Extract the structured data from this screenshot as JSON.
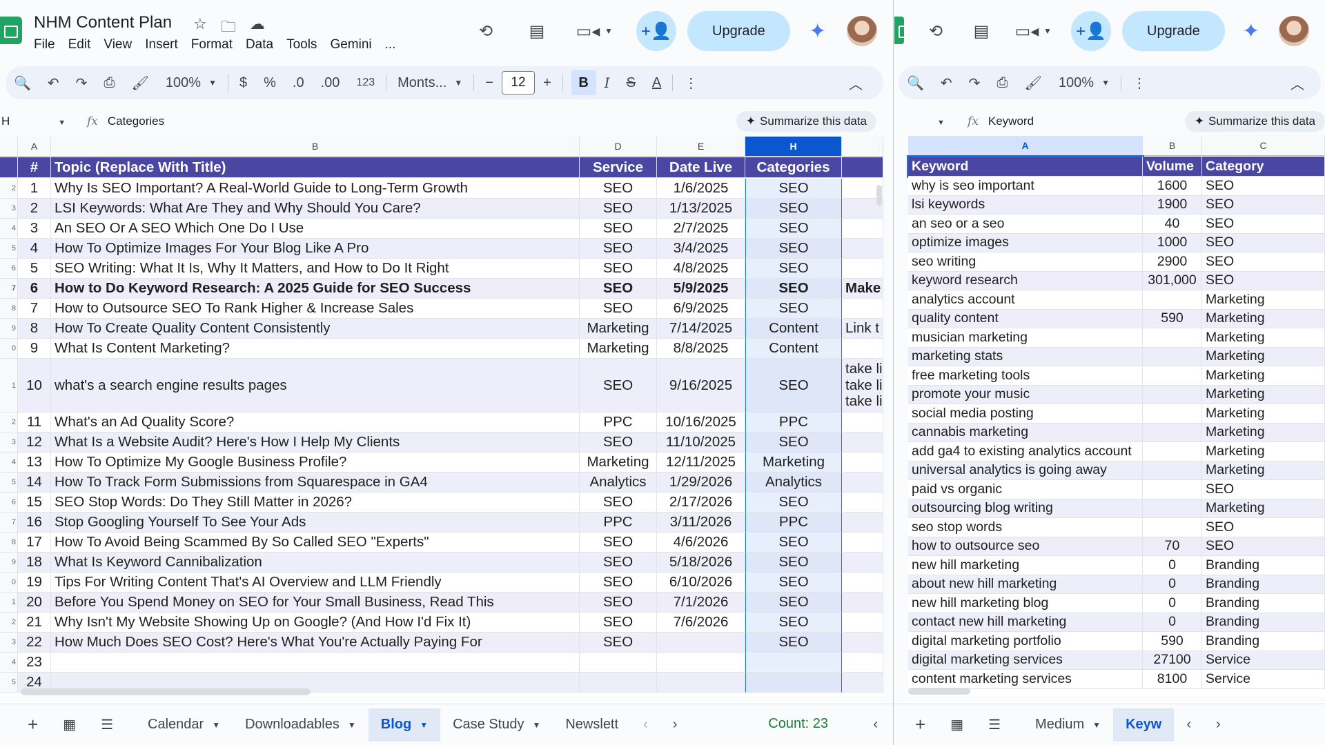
{
  "left": {
    "doc_title": "NHM Content Plan",
    "menu": [
      "File",
      "Edit",
      "View",
      "Insert",
      "Format",
      "Data",
      "Tools",
      "Gemini",
      "..."
    ],
    "upgrade_label": "Upgrade",
    "zoom": "100%",
    "currency": "$",
    "percent": "%",
    "dec_less": ".0",
    "dec_more": ".00",
    "num_fmt": "123",
    "font_name": "Monts...",
    "font_size": "12",
    "name_box": "H",
    "formula": "Categories",
    "summarize_label": "Summarize this data",
    "col_letters": [
      "A",
      "B",
      "D",
      "E",
      "H"
    ],
    "header": [
      "#",
      "Topic (Replace With Title)",
      "Service",
      "Date Live",
      "Categories"
    ],
    "row_numbers": [
      "",
      "",
      "2",
      "3",
      "4",
      "5",
      "6",
      "7",
      "8",
      "9",
      "0",
      "1",
      "2",
      "3",
      "4",
      "5",
      "6",
      "7",
      "8",
      "9",
      "0",
      "1",
      "2",
      "3",
      "4",
      "5"
    ],
    "rows": [
      {
        "n": "1",
        "topic": "Why Is SEO Important? A Real-World Guide to Long-Term Growth",
        "service": "SEO",
        "date": "1/6/2025",
        "cat": "SEO",
        "extra": ""
      },
      {
        "n": "2",
        "topic": "LSI Keywords: What Are They and Why Should You Care?",
        "service": "SEO",
        "date": "1/13/2025",
        "cat": "SEO",
        "extra": ""
      },
      {
        "n": "3",
        "topic": "An SEO Or A SEO Which One Do I Use",
        "service": "SEO",
        "date": "2/7/2025",
        "cat": "SEO",
        "extra": ""
      },
      {
        "n": "4",
        "topic": "How To Optimize Images For Your Blog Like A Pro",
        "service": "SEO",
        "date": "3/4/2025",
        "cat": "SEO",
        "extra": ""
      },
      {
        "n": "5",
        "topic": "SEO Writing: What It Is, Why It Matters, and How to Do It Right",
        "service": "SEO",
        "date": "4/8/2025",
        "cat": "SEO",
        "extra": ""
      },
      {
        "n": "6",
        "topic": "How to Do Keyword Research: A 2025 Guide for SEO Success",
        "service": "SEO",
        "date": "5/9/2025",
        "cat": "SEO",
        "extra": "Make"
      },
      {
        "n": "7",
        "topic": "How to Outsource SEO To Rank Higher & Increase Sales",
        "service": "SEO",
        "date": "6/9/2025",
        "cat": "SEO",
        "extra": ""
      },
      {
        "n": "8",
        "topic": "How To Create Quality Content Consistently",
        "service": "Marketing",
        "date": "7/14/2025",
        "cat": "Content",
        "extra": "Link t"
      },
      {
        "n": "9",
        "topic": "What Is Content Marketing?",
        "service": "Marketing",
        "date": "8/8/2025",
        "cat": "Content",
        "extra": ""
      },
      {
        "n": "10",
        "topic": "what's a search engine results pages",
        "service": "SEO",
        "date": "9/16/2025",
        "cat": "SEO",
        "extra": "take li\ntake li\ntake li"
      },
      {
        "n": "11",
        "topic": "What's an Ad Quality Score?",
        "service": "PPC",
        "date": "10/16/2025",
        "cat": "PPC",
        "extra": ""
      },
      {
        "n": "12",
        "topic": "What Is a Website Audit? Here's How I Help My Clients",
        "service": "SEO",
        "date": "11/10/2025",
        "cat": "SEO",
        "extra": ""
      },
      {
        "n": "13",
        "topic": "How To Optimize My Google Business Profile?",
        "service": "Marketing",
        "date": "12/11/2025",
        "cat": "Marketing",
        "extra": ""
      },
      {
        "n": "14",
        "topic": "How To Track Form Submissions from Squarespace in GA4",
        "service": "Analytics",
        "date": "1/29/2026",
        "cat": "Analytics",
        "extra": ""
      },
      {
        "n": "15",
        "topic": "SEO Stop Words: Do They Still Matter in 2026?",
        "service": "SEO",
        "date": "2/17/2026",
        "cat": "SEO",
        "extra": ""
      },
      {
        "n": "16",
        "topic": "Stop Googling Yourself To See Your Ads",
        "service": "PPC",
        "date": "3/11/2026",
        "cat": "PPC",
        "extra": ""
      },
      {
        "n": "17",
        "topic": "How To Avoid Being Scammed By So Called SEO \"Experts\"",
        "service": "SEO",
        "date": "4/6/2026",
        "cat": "SEO",
        "extra": ""
      },
      {
        "n": "18",
        "topic": "What Is Keyword Cannibalization",
        "service": "SEO",
        "date": "5/18/2026",
        "cat": "SEO",
        "extra": ""
      },
      {
        "n": "19",
        "topic": "Tips For Writing Content That's AI Overview and LLM Friendly",
        "service": "SEO",
        "date": "6/10/2026",
        "cat": "SEO",
        "extra": ""
      },
      {
        "n": "20",
        "topic": "Before You Spend Money on SEO for Your Small Business, Read This",
        "service": "SEO",
        "date": "7/1/2026",
        "cat": "SEO",
        "extra": ""
      },
      {
        "n": "21",
        "topic": "Why Isn't My Website Showing Up on Google? (And How I'd Fix It)",
        "service": "SEO",
        "date": "7/6/2026",
        "cat": "SEO",
        "extra": ""
      },
      {
        "n": "22",
        "topic": "How Much Does SEO Cost? Here's What You're Actually Paying For",
        "service": "SEO",
        "date": "",
        "cat": "SEO",
        "extra": ""
      },
      {
        "n": "23",
        "topic": "",
        "service": "",
        "date": "",
        "cat": "",
        "extra": ""
      },
      {
        "n": "24",
        "topic": "",
        "service": "",
        "date": "",
        "cat": "",
        "extra": ""
      }
    ],
    "tabs": [
      "Calendar",
      "Downloadables",
      "Blog",
      "Case Study",
      "Newslett"
    ],
    "active_tab": "Blog",
    "count": "Count: 23"
  },
  "right": {
    "upgrade_label": "Upgrade",
    "zoom": "100%",
    "formula": "Keyword",
    "summarize_label": "Summarize this data",
    "col_letters": [
      "A",
      "B",
      "C"
    ],
    "header": [
      "Keyword",
      "Volume",
      "Category"
    ],
    "rows": [
      {
        "k": "why is seo important",
        "v": "1600",
        "c": "SEO"
      },
      {
        "k": "lsi keywords",
        "v": "1900",
        "c": "SEO"
      },
      {
        "k": "an seo or a seo",
        "v": "40",
        "c": "SEO"
      },
      {
        "k": "optimize images",
        "v": "1000",
        "c": "SEO"
      },
      {
        "k": "seo writing",
        "v": "2900",
        "c": "SEO"
      },
      {
        "k": "keyword research",
        "v": "301,000",
        "c": "SEO"
      },
      {
        "k": "analytics account",
        "v": "",
        "c": "Marketing"
      },
      {
        "k": "quality content",
        "v": "590",
        "c": "Marketing"
      },
      {
        "k": "musician marketing",
        "v": "",
        "c": "Marketing"
      },
      {
        "k": "marketing stats",
        "v": "",
        "c": "Marketing"
      },
      {
        "k": "free marketing tools",
        "v": "",
        "c": "Marketing"
      },
      {
        "k": "promote your music",
        "v": "",
        "c": "Marketing"
      },
      {
        "k": "social media posting",
        "v": "",
        "c": "Marketing"
      },
      {
        "k": "cannabis marketing",
        "v": "",
        "c": "Marketing"
      },
      {
        "k": "add ga4 to existing analytics account",
        "v": "",
        "c": "Marketing"
      },
      {
        "k": "universal analytics is going away",
        "v": "",
        "c": "Marketing"
      },
      {
        "k": "paid vs organic",
        "v": "",
        "c": "SEO"
      },
      {
        "k": "outsourcing blog writing",
        "v": "",
        "c": "Marketing"
      },
      {
        "k": "seo stop words",
        "v": "",
        "c": "SEO"
      },
      {
        "k": "how to outsource seo",
        "v": "70",
        "c": "SEO"
      },
      {
        "k": "new hill marketing",
        "v": "0",
        "c": "Branding"
      },
      {
        "k": "about new hill marketing",
        "v": "0",
        "c": "Branding"
      },
      {
        "k": "new hill marketing blog",
        "v": "0",
        "c": "Branding"
      },
      {
        "k": "contact new hill marketing",
        "v": "0",
        "c": "Branding"
      },
      {
        "k": "digital marketing portfolio",
        "v": "590",
        "c": "Branding"
      },
      {
        "k": "digital marketing services",
        "v": "27100",
        "c": "Service"
      },
      {
        "k": "content marketing services",
        "v": "8100",
        "c": "Service"
      }
    ],
    "tabs": [
      "Medium",
      "Keyw"
    ],
    "active_tab": "Keyw"
  }
}
